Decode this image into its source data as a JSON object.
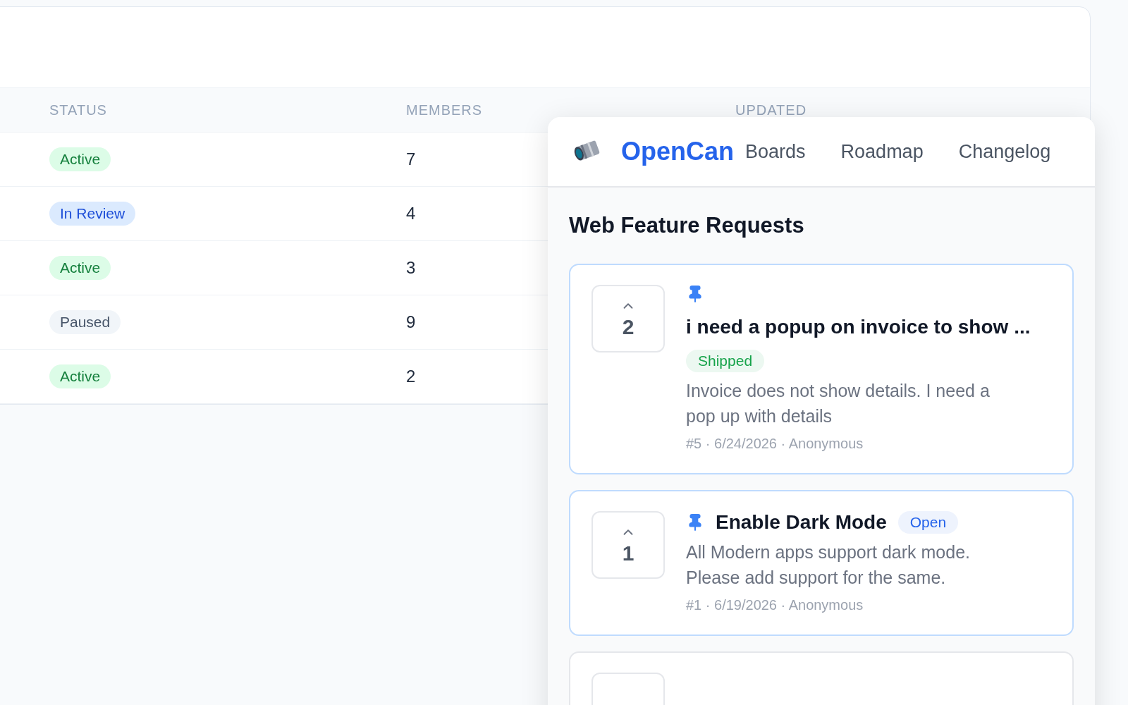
{
  "table": {
    "columns": [
      "STATUS",
      "MEMBERS",
      "UPDATED"
    ],
    "rows": [
      {
        "status": "Active",
        "kind": "active",
        "members": "7"
      },
      {
        "status": "In Review",
        "kind": "review",
        "members": "4"
      },
      {
        "status": "Active",
        "kind": "active",
        "members": "3"
      },
      {
        "status": "Paused",
        "kind": "paused",
        "members": "9"
      },
      {
        "status": "Active",
        "kind": "active",
        "members": "2"
      }
    ]
  },
  "widget": {
    "brand": "OpenCan",
    "nav": [
      {
        "label": "Boards"
      },
      {
        "label": "Roadmap"
      },
      {
        "label": "Changelog"
      }
    ],
    "board_title": "Web Feature Requests",
    "posts": [
      {
        "kind": "stacked",
        "votes": "2",
        "pinned": true,
        "title": "i need a popup on invoice to show ...",
        "status": {
          "label": "Shipped",
          "color": "#16a34a"
        },
        "description": "Invoice does not show details. I need a pop up with details",
        "meta": "#5 · 6/24/2026 · Anonymous"
      },
      {
        "kind": "inline",
        "votes": "1",
        "pinned": true,
        "title": "Enable Dark Mode",
        "status": {
          "label": "Open",
          "color": "#2563eb"
        },
        "description": "All Modern apps support dark mode. Please add support for the same.",
        "meta": "#1 · 6/19/2026 · Anonymous"
      },
      {
        "kind": "cut"
      }
    ]
  }
}
